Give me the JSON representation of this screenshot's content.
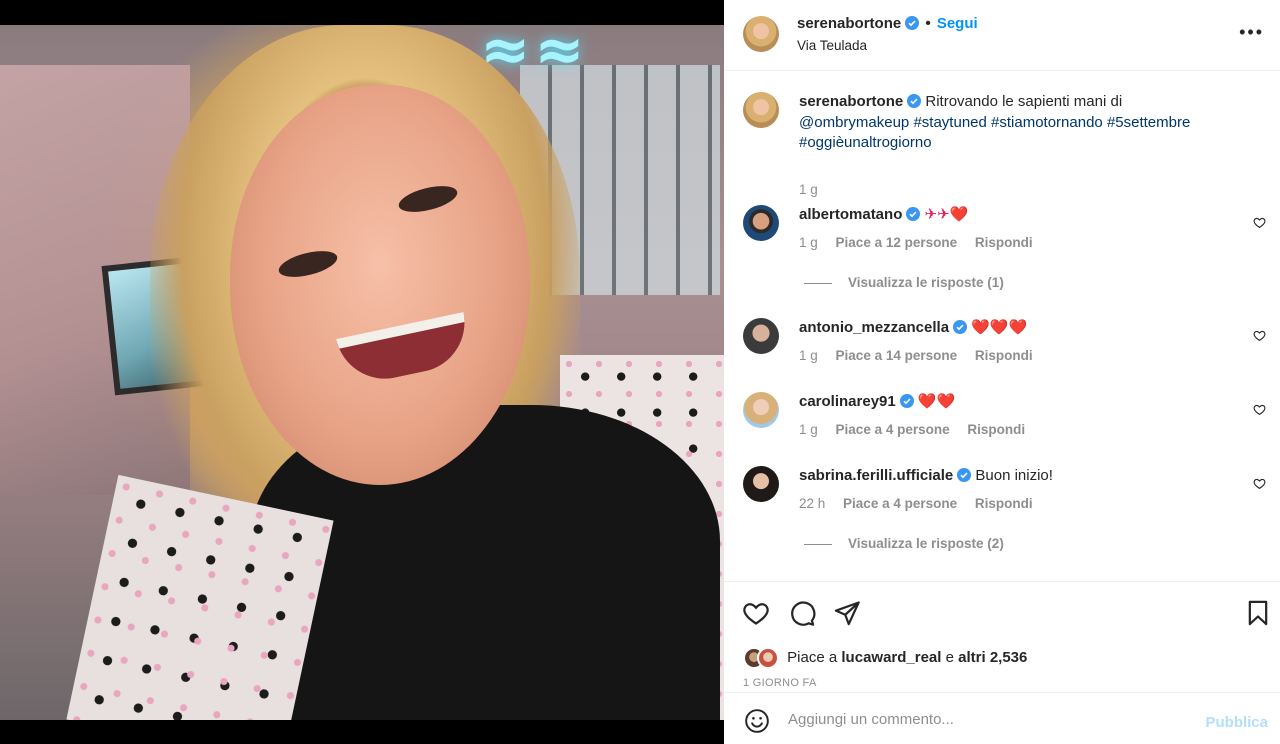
{
  "post": {
    "author": "serenabortone",
    "location": "Via Teulada",
    "follow_label": "Segui",
    "dot": "•",
    "more_icon": "more-horizontal-icon",
    "caption_text": "Ritrovando le sapienti mani di",
    "caption_tags": [
      "@ombrymakeup",
      "#staytuned",
      "#stiamotornando",
      "#5settembre",
      "#oggièunaltrogiorno"
    ],
    "caption_time": "1 g"
  },
  "comments": [
    {
      "user": "albertomatano",
      "text": "✈✈❤️",
      "time": "1 g",
      "likes": "Piace a 12 persone",
      "reply": "Rispondi",
      "replies": "Visualizza le risposte (1)"
    },
    {
      "user": "antonio_mezzancella",
      "text": "❤️❤️❤️",
      "time": "1 g",
      "likes": "Piace a 14 persone",
      "reply": "Rispondi"
    },
    {
      "user": "carolinarey91",
      "text": "❤️❤️",
      "time": "1 g",
      "likes": "Piace a 4 persone",
      "reply": "Rispondi"
    },
    {
      "user": "sabrina.ferilli.ufficiale",
      "text": "Buon inizio!",
      "time": "22 h",
      "likes": "Piace a 4 persone",
      "reply": "Rispondi",
      "replies": "Visualizza le risposte (2)"
    }
  ],
  "likes": {
    "prefix": "Piace a",
    "user": "lucaward_real",
    "conj": "e",
    "others": "altri 2,536"
  },
  "posted_ago": "1 GIORNO FA",
  "composer": {
    "placeholder": "Aggiungi un commento...",
    "publish_label": "Pubblica",
    "emoji_icon": "emoji-icon"
  },
  "colors": {
    "accent": "#0095f6",
    "verified": "#3897f0",
    "publish_disabled": "#b2dffc",
    "muted": "#8e8e8e"
  }
}
